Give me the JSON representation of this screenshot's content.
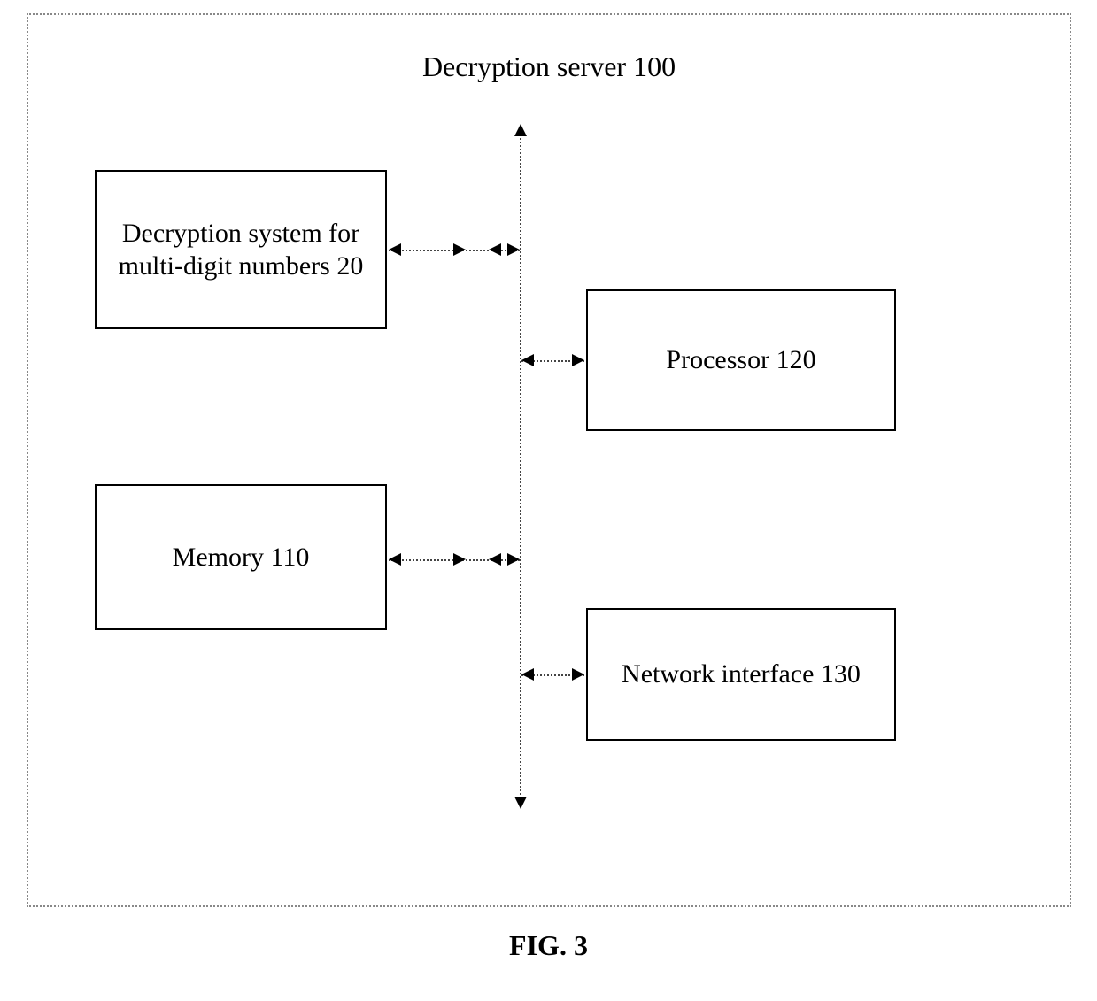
{
  "diagram": {
    "title": "Decryption server 100",
    "boxes": {
      "decryption": "Decryption system for multi-digit numbers 20",
      "memory": "Memory 110",
      "processor": "Processor 120",
      "network": "Network interface 130"
    },
    "figure_label": "FIG. 3"
  }
}
